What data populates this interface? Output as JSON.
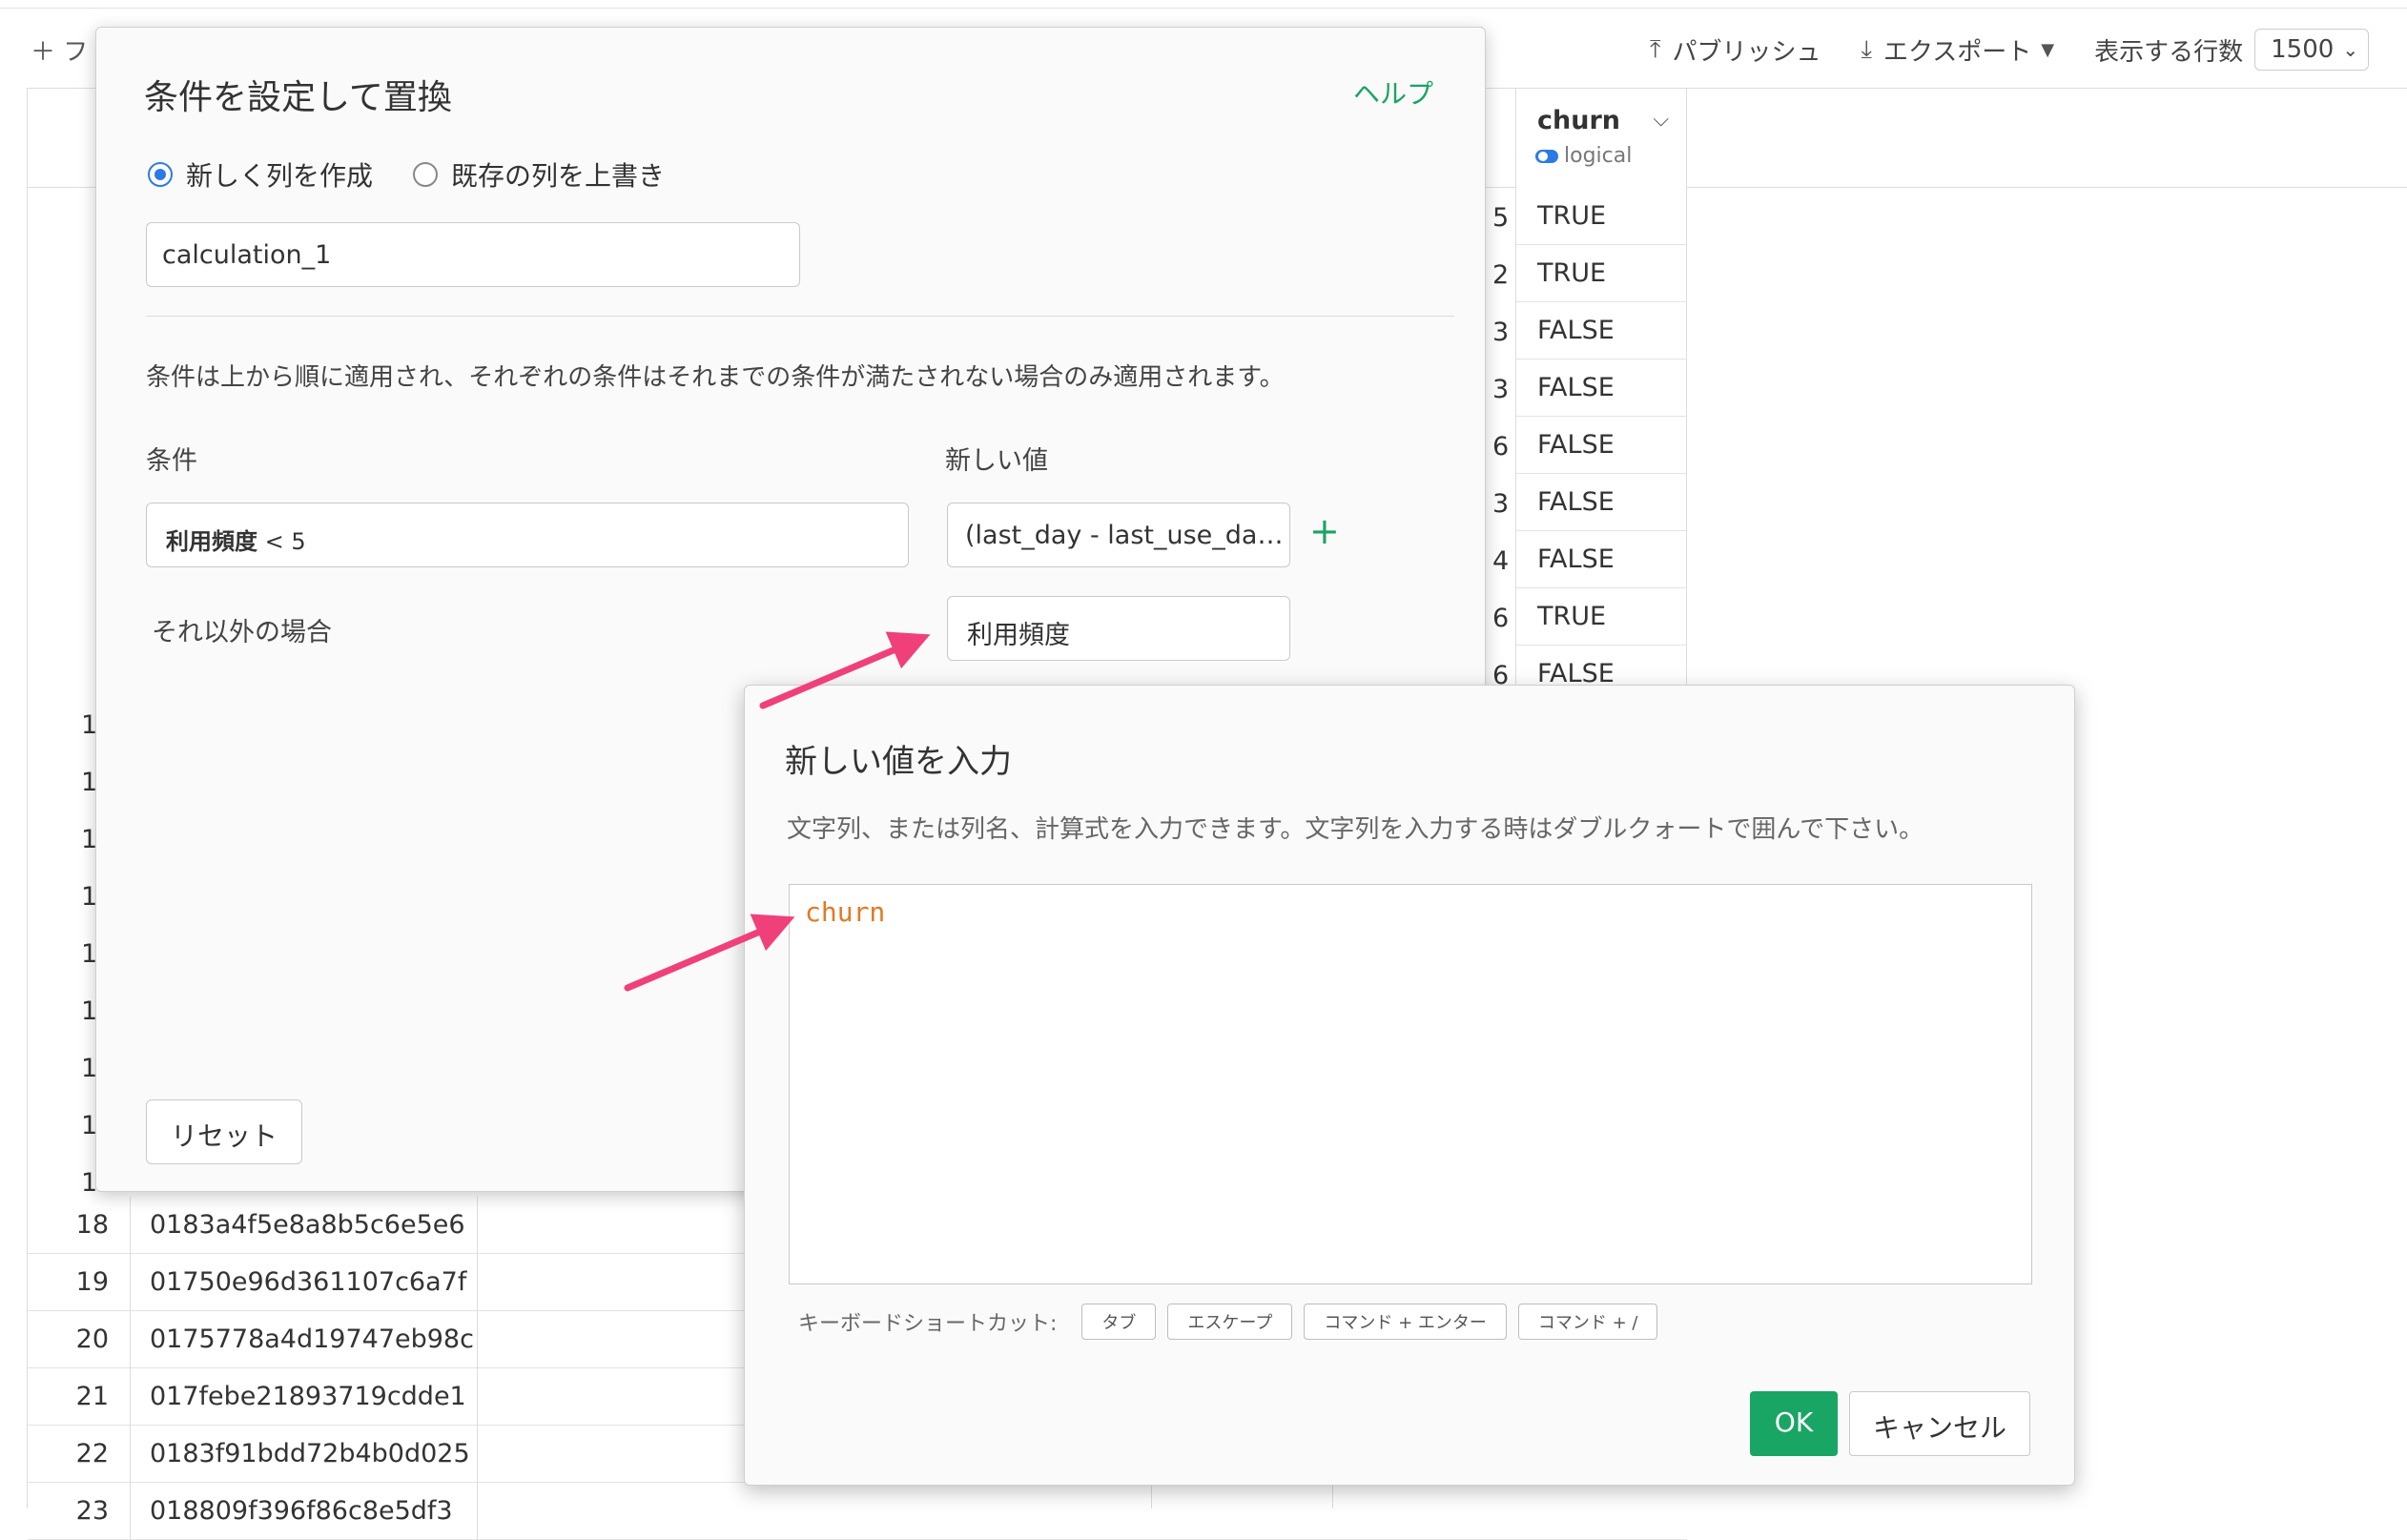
{
  "background": {
    "add_filter": "＋ フ",
    "toolbar": {
      "publish": "パブリッシュ",
      "export": "エクスポート",
      "rows_label": "表示する行数",
      "rows_value": "1500"
    },
    "churn_column": {
      "name": "churn",
      "type": "logical"
    },
    "churn_values": [
      "TRUE",
      "TRUE",
      "FALSE",
      "FALSE",
      "FALSE",
      "FALSE",
      "FALSE",
      "TRUE",
      "FALSE"
    ],
    "prev_column_digits": [
      "5",
      "2",
      "3",
      "3",
      "6",
      "3",
      "4",
      "6",
      "6"
    ],
    "row_number_fragments": [
      "1",
      "1",
      "1",
      "1",
      "1",
      "1",
      "1",
      "1",
      "1"
    ],
    "rows": [
      {
        "num": "18",
        "id": "0183a4f5e8a8b5c6e5e6"
      },
      {
        "num": "19",
        "id": "01750e96d361107c6a7f"
      },
      {
        "num": "20",
        "id": "0175778a4d19747eb98c"
      },
      {
        "num": "21",
        "id": "017febe21893719cdde1"
      },
      {
        "num": "22",
        "id": "0183f91bdd72b4b0d025"
      },
      {
        "num": "23",
        "id": "018809f396f86c8e5df3"
      }
    ]
  },
  "dialog1": {
    "title": "条件を設定して置換",
    "help": "ヘルプ",
    "radio_new": "新しく列を作成",
    "radio_overwrite": "既存の列を上書き",
    "column_name_value": "calculation_1",
    "description": "条件は上から順に適用され、それぞれの条件はそれまでの条件が満たされない場合のみ適用されます。",
    "condition_label": "条件",
    "new_value_label": "新しい値",
    "condition_field": "利用頻度",
    "condition_op": " < 5",
    "condition_value": "(last_day - last_use_da…",
    "else_label": "それ以外の場合",
    "else_value": "利用頻度",
    "reset": "リセット"
  },
  "dialog2": {
    "title": "新しい値を入力",
    "description": "文字列、または列名、計算式を入力できます。文字列を入力する時はダブルクォートで囲んで下さい。",
    "editor_value": "churn",
    "shortcut_label": "キーボードショートカット:",
    "keys": [
      "タブ",
      "エスケープ",
      "コマンド + エンター",
      "コマンド + /"
    ],
    "ok": "OK",
    "cancel": "キャンセル"
  },
  "colors": {
    "accent_green": "#19a564",
    "arrow_pink": "#f0407a",
    "editor_text": "#e07b24",
    "radio_blue": "#2c7be5"
  }
}
